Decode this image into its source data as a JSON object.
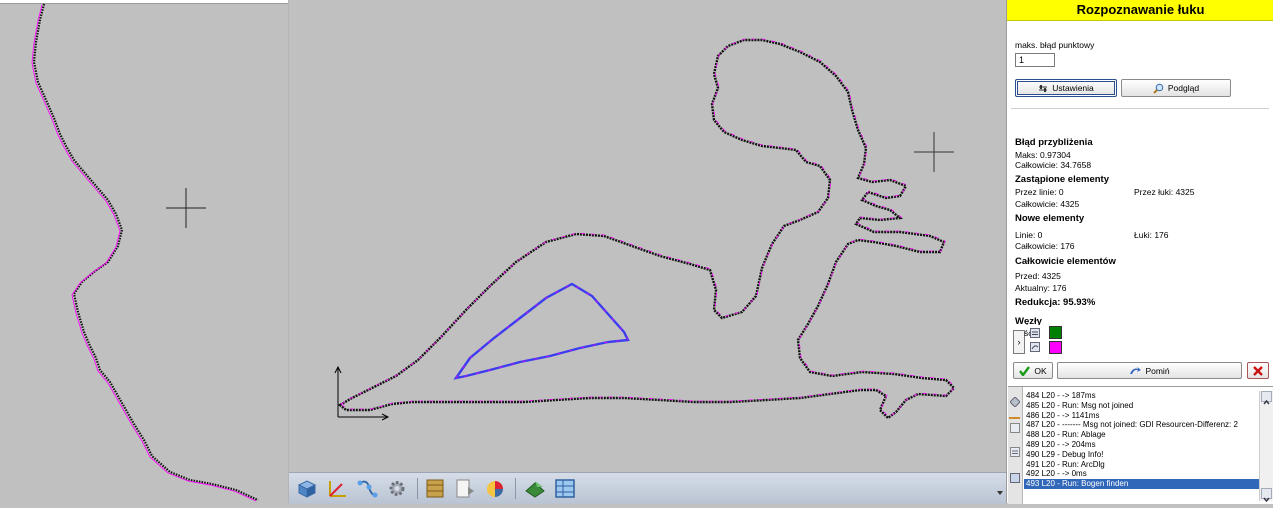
{
  "panel": {
    "title": "Rozpoznawanie łuku",
    "max_error_label": "maks. błąd punktowy",
    "max_error_value": "1",
    "settings_button": "Ustawienia",
    "preview_button": "Podgląd",
    "approx_error": {
      "heading": "Błąd przybliżenia",
      "max": "Maks: 0.97304",
      "total": "Całkowicie: 34.7658"
    },
    "replaced": {
      "heading": "Zastąpione elementy",
      "by_lines": "Przez linie: 0",
      "by_arcs": "Przez łuki: 4325",
      "total": "Całkowicie: 4325"
    },
    "new_elements": {
      "heading": "Nowe elementy",
      "lines": "Linie: 0",
      "arcs": "Łuki: 176",
      "total": "Całkowicie: 176"
    },
    "total_elements": {
      "heading": "Całkowicie elementów",
      "before": "Przed: 4325",
      "current": "Aktualny: 176"
    },
    "reduction": "Redukcja: 95.93%",
    "nodes": {
      "heading": "Węzły",
      "partial_label": "ść"
    },
    "ok_button": "OK",
    "skip_button": "Pomiń",
    "colors": {
      "node_green": "#008000",
      "node_magenta": "#ff00ff",
      "title_bg": "#ffff00"
    }
  },
  "log": {
    "lines": [
      "484 L20 - -> 187ms",
      "485 L20 - Run: Msg not joined",
      "486 L20 - -> 1141ms",
      "487 L20 - -------  Msg not joined: GDI Resourcen-Differenz: 2",
      "488 L20 - Run: Ablage",
      "489 L20 - -> 204ms",
      "490 L29 - Debug Info!",
      "491 L20 - Run: ArcDlg",
      "492 L20 - -> 0ms",
      "493 L20 - Run: Bogen finden"
    ],
    "selected_index": 9
  },
  "toolbar": {
    "icons": [
      "3d-view-icon",
      "axes-icon",
      "nodes-icon",
      "gear-icon",
      "film-icon",
      "page-arrow-icon",
      "chart-icon",
      "tool-arrow-icon",
      "grid-icon"
    ]
  },
  "canvas": {
    "outline_color": "#000000",
    "arc_marker_color": "#ff00ff",
    "selected_contour_color": "#3b3bf0",
    "background": "#c0c0c0"
  }
}
